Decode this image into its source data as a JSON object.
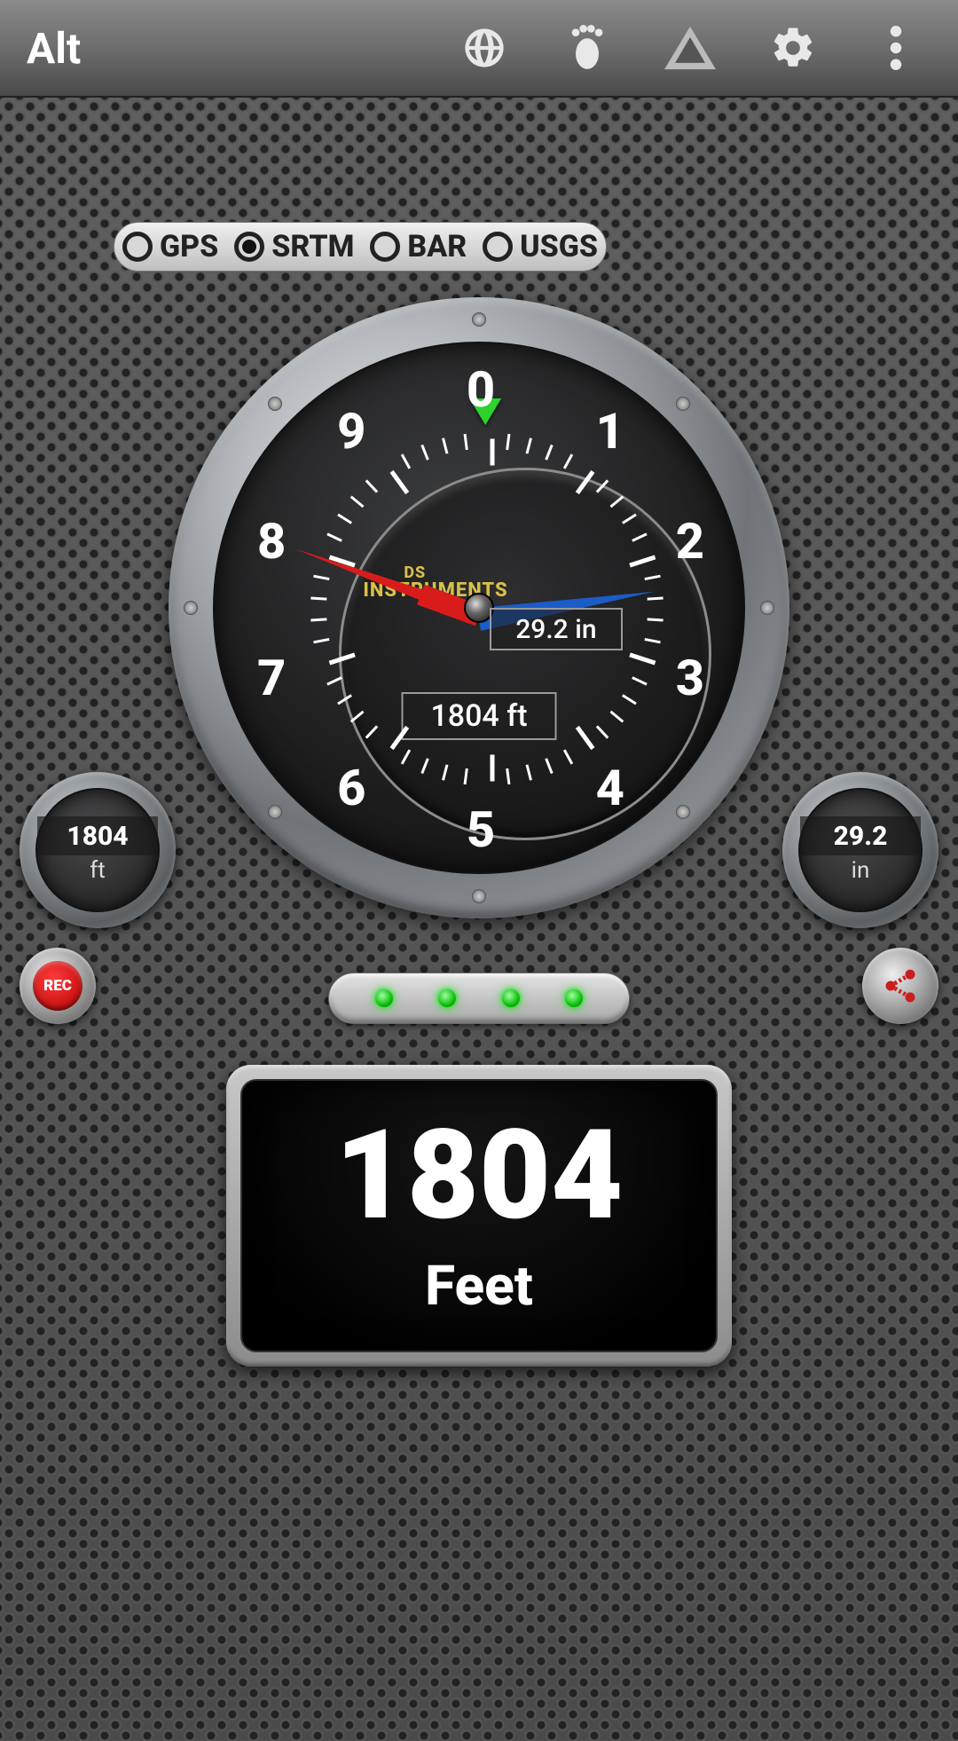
{
  "header": {
    "title": "Alt"
  },
  "sources": {
    "options": [
      "GPS",
      "SRTM",
      "BAR",
      "USGS"
    ],
    "selected": "SRTM"
  },
  "gauge": {
    "brand_line1": "DS",
    "brand_line2": "INSTRUMENTS",
    "numbers": [
      "0",
      "1",
      "2",
      "3",
      "4",
      "5",
      "6",
      "7",
      "8",
      "9"
    ],
    "pressure_label": "29.2 in",
    "altitude_label": "1804 ft",
    "needle_short_angle_deg": 200,
    "needle_long_angle_deg": -9
  },
  "mini_left": {
    "value": "1804",
    "unit": "ft"
  },
  "mini_right": {
    "value": "29.2",
    "unit": "in"
  },
  "record": {
    "label": "REC"
  },
  "leds": {
    "count": 4,
    "lit": 4
  },
  "digital": {
    "value": "1804",
    "unit": "Feet"
  }
}
